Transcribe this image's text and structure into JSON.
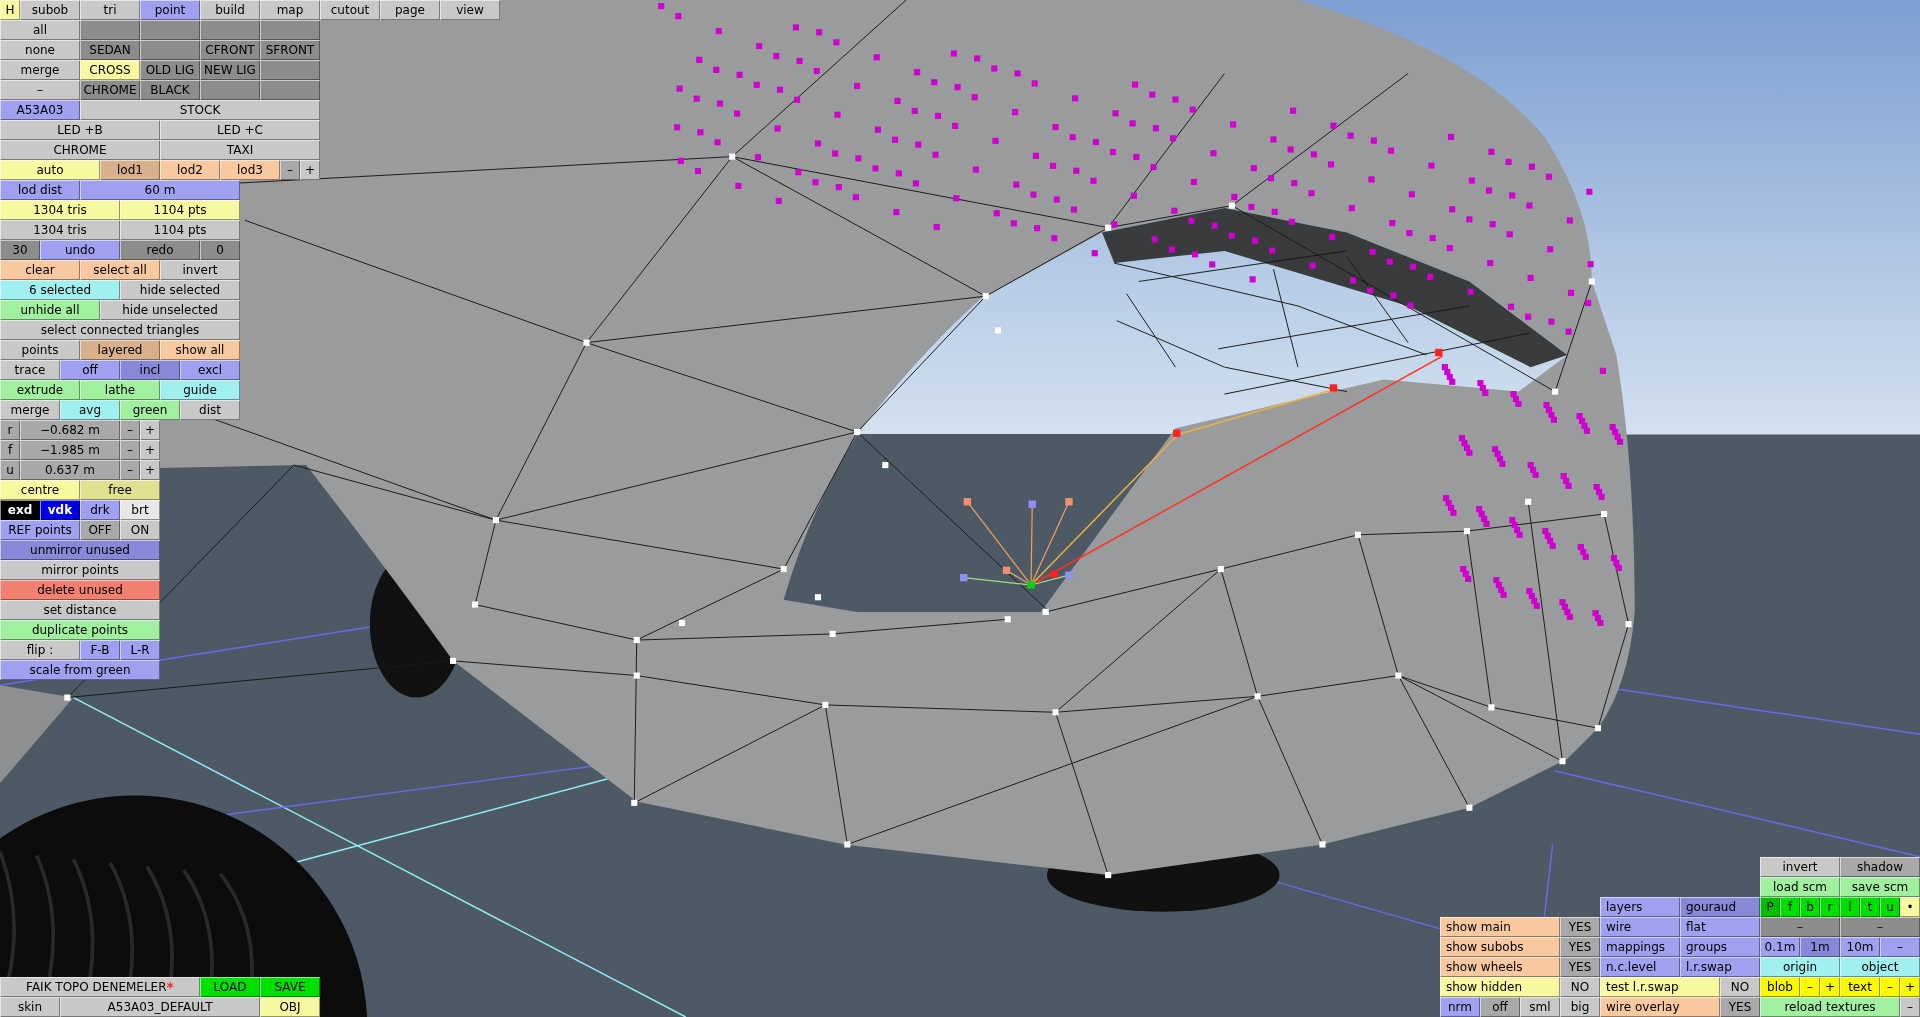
{
  "left_panel": {
    "strips": [
      {
        "buttons": [
          {
            "text": "H",
            "color": "#f8f8a0"
          },
          {
            "text": "subob",
            "color": "#c8c8c8"
          },
          {
            "text": "tri",
            "color": "#c8c8c8"
          },
          {
            "text": "point",
            "color": "#a0a0f0"
          },
          {
            "text": "build",
            "color": "#c8c8c8"
          },
          {
            "text": "map",
            "color": "#c8c8c8"
          },
          {
            "text": "cutout",
            "color": "#c8c8c8"
          },
          {
            "text": "page",
            "color": "#c8c8c8"
          },
          {
            "text": "view",
            "color": "#c8c8c8"
          }
        ]
      },
      {
        "buttons": [
          {
            "text": "all",
            "color": "#c8c8c8"
          },
          {
            "color": "#8c8c8c"
          },
          {
            "color": "#8c8c8c"
          },
          {
            "color": "#8c8c8c"
          },
          {
            "color": "#8c8c8c"
          }
        ]
      },
      {
        "buttons": [
          {
            "text": "none",
            "color": "#c8c8c8"
          },
          {
            "text": "SEDAN",
            "color": "#8c8c8c"
          },
          {
            "color": "#8c8c8c"
          },
          {
            "text": "CFRONT",
            "color": "#8c8c8c"
          },
          {
            "text": "SFRONT",
            "color": "#8c8c8c"
          }
        ]
      },
      {
        "buttons": [
          {
            "text": "merge",
            "color": "#c8c8c8"
          },
          {
            "text": "CROSS",
            "color": "#f8f8a0"
          },
          {
            "text": "OLD LIG",
            "color": "#8c8c8c"
          },
          {
            "text": "NEW LIG",
            "color": "#8c8c8c"
          },
          {
            "color": "#8c8c8c"
          }
        ]
      },
      {
        "buttons": [
          {
            "text": "–",
            "color": "#c8c8c8"
          },
          {
            "text": "CHROME",
            "color": "#8c8c8c"
          },
          {
            "text": "BLACK",
            "color": "#8c8c8c"
          },
          {
            "color": "#8c8c8c"
          },
          {
            "color": "#8c8c8c"
          }
        ]
      },
      {
        "buttons": [
          {
            "text": "A53A03",
            "color": "#a0a0f0"
          },
          {
            "text": "STOCK",
            "color": "#c8c8c8"
          }
        ]
      },
      {
        "buttons": [
          {
            "text": "LED +B",
            "color": "#c8c8c8"
          },
          {
            "text": "LED +C",
            "color": "#c8c8c8"
          }
        ]
      },
      {
        "buttons": [
          {
            "text": "CHROME",
            "color": "#c8c8c8"
          },
          {
            "text": "TAXI",
            "color": "#c8c8c8"
          }
        ]
      },
      {
        "buttons": [
          {
            "text": "auto",
            "color": "#f8f8a0"
          },
          {
            "text": "lod1",
            "color": "#d8b08c"
          },
          {
            "text": "lod2",
            "color": "#f8c8a0"
          },
          {
            "text": "lod3",
            "color": "#f8c8a0"
          },
          {
            "text": "–",
            "color": "#a8a8a8"
          },
          {
            "text": "+",
            "color": "#c8c8c8"
          }
        ]
      },
      {
        "buttons": [
          {
            "text": "lod dist",
            "color": "#a0a0f0"
          },
          {
            "text": "60 m",
            "color": "#a0a0f0"
          }
        ]
      },
      {
        "buttons": [
          {
            "text": "1304 tris",
            "color": "#f8f8a0"
          },
          {
            "text": "1104 pts",
            "color": "#f8f8a0"
          }
        ]
      },
      {
        "buttons": [
          {
            "text": "1304 tris",
            "color": "#c8c8c8"
          },
          {
            "text": "1104 pts",
            "color": "#c8c8c8"
          }
        ]
      },
      {
        "buttons": [
          {
            "text": "30",
            "color": "#8c8c8c"
          },
          {
            "text": "undo",
            "color": "#a0a0f0"
          },
          {
            "text": "redo",
            "color": "#8c8c8c"
          },
          {
            "text": "0",
            "color": "#8c8c8c"
          }
        ]
      },
      {
        "buttons": [
          {
            "text": "clear",
            "color": "#f8c8a0"
          },
          {
            "text": "select all",
            "color": "#f8c8a0"
          },
          {
            "text": "invert",
            "color": "#c8c8c8"
          }
        ]
      },
      {
        "buttons": [
          {
            "text": "6 selected",
            "color": "#a0f0f0"
          },
          {
            "text": "hide selected",
            "color": "#c8c8c8"
          }
        ]
      },
      {
        "buttons": [
          {
            "text": "unhide all",
            "color": "#a0f0a0"
          },
          {
            "text": "hide unselected",
            "color": "#c8c8c8"
          }
        ]
      },
      {
        "buttons": [
          {
            "text": "select connected triangles",
            "color": "#c8c8c8"
          }
        ]
      },
      {
        "buttons": [
          {
            "text": "points",
            "color": "#c8c8c8"
          },
          {
            "text": "layered",
            "color": "#d8b08c"
          },
          {
            "text": "show all",
            "color": "#f8c8a0"
          }
        ]
      },
      {
        "buttons": [
          {
            "text": "trace",
            "color": "#c8c8c8"
          },
          {
            "text": "off",
            "color": "#a0a0f0"
          },
          {
            "text": "incl",
            "color": "#8888d8"
          },
          {
            "text": "excl",
            "color": "#a0a0f0"
          }
        ]
      },
      {
        "buttons": [
          {
            "text": "extrude",
            "color": "#a0f0a0"
          },
          {
            "text": "lathe",
            "color": "#a0f0a0"
          },
          {
            "text": "guide",
            "color": "#a0f0f0"
          }
        ]
      },
      {
        "buttons": [
          {
            "text": "merge",
            "color": "#c8c8c8"
          },
          {
            "text": "avg",
            "color": "#a0f0f0"
          },
          {
            "text": "green",
            "color": "#a0f0a0"
          },
          {
            "text": "dist",
            "color": "#c8c8c8"
          }
        ]
      },
      {
        "buttons": [
          {
            "text": "r",
            "color": "#a8a8a8"
          },
          {
            "text": "−0.682 m",
            "color": "#a8a8a8"
          },
          {
            "text": "–",
            "color": "#a8a8a8"
          },
          {
            "text": "+",
            "color": "#c8c8c8"
          }
        ]
      },
      {
        "buttons": [
          {
            "text": "f",
            "color": "#a8a8a8"
          },
          {
            "text": "−1.985 m",
            "color": "#a8a8a8"
          },
          {
            "text": "–",
            "color": "#a8a8a8"
          },
          {
            "text": "+",
            "color": "#c8c8c8"
          }
        ]
      },
      {
        "buttons": [
          {
            "text": "u",
            "color": "#a8a8a8"
          },
          {
            "text": "0.637 m",
            "color": "#a8a8a8"
          },
          {
            "text": "–",
            "color": "#a8a8a8"
          },
          {
            "text": "+",
            "color": "#c8c8c8"
          }
        ]
      },
      {
        "buttons": [
          {
            "text": "centre",
            "color": "#f8f8a0"
          },
          {
            "text": "free",
            "color": "#e0e090"
          }
        ]
      },
      {
        "buttons": [
          {
            "text": "exd",
            "color": "#000000"
          },
          {
            "text": "vdk",
            "color": "#0000e0"
          },
          {
            "text": "drk",
            "color": "#a0a0f0"
          },
          {
            "text": "brt",
            "color": "#e8e8e8"
          }
        ]
      },
      {
        "buttons": [
          {
            "text": "REF points",
            "color": "#a0a0f0"
          },
          {
            "text": "OFF",
            "color": "#a8a8a8"
          },
          {
            "text": "ON",
            "color": "#c8c8c8"
          }
        ]
      },
      {
        "buttons": [
          {
            "text": "unmirror unused",
            "color": "#8888d8"
          }
        ]
      },
      {
        "buttons": [
          {
            "text": "mirror points",
            "color": "#c8c8c8"
          }
        ]
      },
      {
        "buttons": [
          {
            "text": "delete unused",
            "color": "#f08070"
          }
        ]
      },
      {
        "buttons": [
          {
            "text": "set distance",
            "color": "#c8c8c8"
          }
        ]
      },
      {
        "buttons": [
          {
            "text": "duplicate points",
            "color": "#a0f0a0"
          }
        ]
      },
      {
        "buttons": [
          {
            "text": "flip :",
            "color": "#c8c8c8"
          },
          {
            "text": "F-B",
            "color": "#a0a0f0"
          },
          {
            "text": "L-R",
            "color": "#a0a0f0"
          }
        ]
      },
      {
        "buttons": [
          {
            "text": "scale from green",
            "color": "#a0a0f0"
          }
        ]
      }
    ]
  },
  "file_panel": {
    "strips": [
      {
        "buttons": [
          {
            "text": "FAIK TOPO DENEMELER",
            "mark": "*",
            "color": "#c8c8c8"
          },
          {
            "text": "LOAD",
            "color": "#00e000"
          },
          {
            "text": "SAVE",
            "color": "#00e000"
          }
        ]
      },
      {
        "buttons": [
          {
            "text": "skin",
            "color": "#c8c8c8"
          },
          {
            "text": "A53A03_DEFAULT",
            "color": "#c8c8c8"
          },
          {
            "text": "OBJ",
            "color": "#f8f8a0"
          }
        ]
      }
    ]
  },
  "display_panel": {
    "strips": [
      {
        "buttons": [
          {
            "text": "invert",
            "color": "#c8c8c8"
          },
          {
            "text": "shadow",
            "color": "#a8a8a8"
          }
        ]
      },
      {
        "buttons": [
          {
            "text": "load scm",
            "color": "#a0f0a0"
          },
          {
            "text": "save scm",
            "color": "#a0f0a0"
          }
        ]
      },
      {
        "buttons": [
          {
            "text": "layers",
            "color": "#a0a0f0"
          },
          {
            "text": "gouraud",
            "color": "#8888d8"
          },
          {
            "text": "P",
            "color": "#00c000"
          },
          {
            "text": "f",
            "color": "#00e000"
          },
          {
            "text": "b",
            "color": "#00e000"
          },
          {
            "text": "r",
            "color": "#00e000"
          },
          {
            "text": "l",
            "color": "#00e000"
          },
          {
            "text": "t",
            "color": "#00e000"
          },
          {
            "text": "u",
            "color": "#00e000"
          },
          {
            "text": "•",
            "color": "#f8f8a0"
          }
        ]
      },
      {
        "buttons": [
          {
            "text": "show main",
            "color": "#f8c8a0"
          },
          {
            "text": "YES",
            "color": "#a8a8a8"
          },
          {
            "text": "wire",
            "color": "#a0a0f0"
          },
          {
            "text": "flat",
            "color": "#a0a0f0"
          },
          {
            "text": "–",
            "color": "#8c8c8c"
          },
          {
            "text": "–",
            "color": "#8c8c8c"
          }
        ]
      },
      {
        "buttons": [
          {
            "text": "show subobs",
            "color": "#f8c8a0"
          },
          {
            "text": "YES",
            "color": "#a8a8a8"
          },
          {
            "text": "mappings",
            "color": "#a0a0f0"
          },
          {
            "text": "groups",
            "color": "#a0a0f0"
          },
          {
            "text": "0.1m",
            "color": "#a0a0f0"
          },
          {
            "text": "1m",
            "color": "#8888d8"
          },
          {
            "text": "10m",
            "color": "#a0a0f0"
          },
          {
            "text": "–",
            "color": "#a0a0f0"
          }
        ]
      },
      {
        "buttons": [
          {
            "text": "show wheels",
            "color": "#f8c8a0"
          },
          {
            "text": "YES",
            "color": "#a8a8a8"
          },
          {
            "text": "n.c.level",
            "color": "#a0a0f0"
          },
          {
            "text": "l.r.swap",
            "color": "#a0a0f0"
          },
          {
            "text": "origin",
            "color": "#a0f0f0"
          },
          {
            "text": "object",
            "color": "#a0f0f0"
          }
        ]
      },
      {
        "buttons": [
          {
            "text": "show hidden",
            "color": "#f8f8a0"
          },
          {
            "text": "NO",
            "color": "#c8c8c8"
          },
          {
            "text": "test l.r.swap",
            "color": "#f8f8a0"
          },
          {
            "text": "NO",
            "color": "#c8c8c8"
          },
          {
            "text": "blob",
            "color": "#f8f800"
          },
          {
            "text": "–",
            "color": "#f8f800"
          },
          {
            "text": "+",
            "color": "#f8f800"
          },
          {
            "text": "text",
            "color": "#f8f800"
          },
          {
            "text": "–",
            "color": "#f8f800"
          },
          {
            "text": "+",
            "color": "#f8f800"
          }
        ]
      },
      {
        "buttons": [
          {
            "text": "nrm",
            "color": "#a0a0f0"
          },
          {
            "text": "off",
            "color": "#a8a8a8"
          },
          {
            "text": "sml",
            "color": "#c8c8c8"
          },
          {
            "text": "big",
            "color": "#c8c8c8"
          },
          {
            "text": "wire overlay",
            "color": "#f8c8a0"
          },
          {
            "text": "YES",
            "color": "#a8a8a8"
          },
          {
            "text": "reload textures",
            "color": "#a0f0a0"
          },
          {
            "text": "–",
            "color": "#c8c8c8"
          }
        ]
      }
    ]
  }
}
